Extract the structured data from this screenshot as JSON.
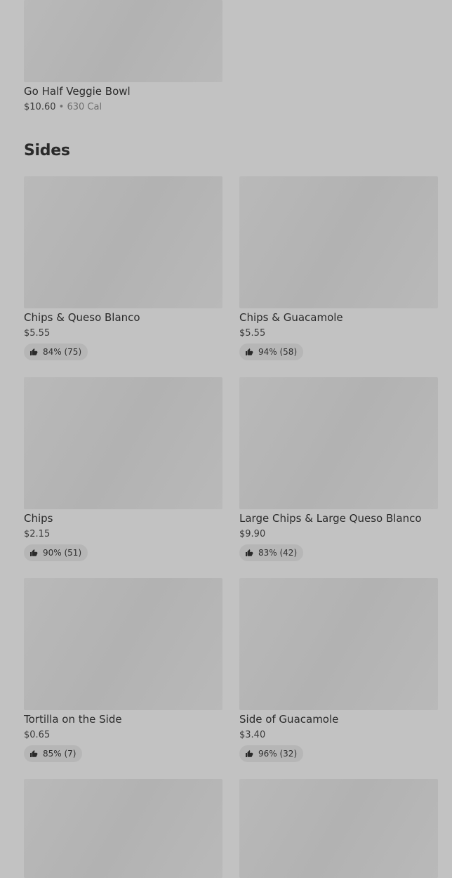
{
  "top_item": {
    "name": "Go Half Veggie Bowl",
    "price": "$10.60",
    "separator": "•",
    "calories": "630 Cal"
  },
  "sides": {
    "heading": "Sides",
    "items": [
      {
        "name": "Chips & Queso Blanco",
        "price": "$5.55",
        "rating": "84% (75)"
      },
      {
        "name": "Chips & Guacamole",
        "price": "$5.55",
        "rating": "94% (58)"
      },
      {
        "name": "Chips",
        "price": "$2.15",
        "rating": "90% (51)"
      },
      {
        "name": "Large Chips & Large Queso Blanco",
        "price": "$9.90",
        "rating": "83% (42)"
      },
      {
        "name": "Tortilla on the Side",
        "price": "$0.65",
        "rating": "85% (7)"
      },
      {
        "name": "Side of Guacamole",
        "price": "$3.40",
        "rating": "96% (32)"
      }
    ]
  },
  "icons": {
    "rating": "thumbs-up-icon"
  },
  "colors": {
    "background": "#c2c2c2",
    "image_placeholder": "#b6b6b6",
    "badge": "#b6b6b6",
    "text": "#2b2b2b",
    "muted_text": "#6f6f6f"
  }
}
